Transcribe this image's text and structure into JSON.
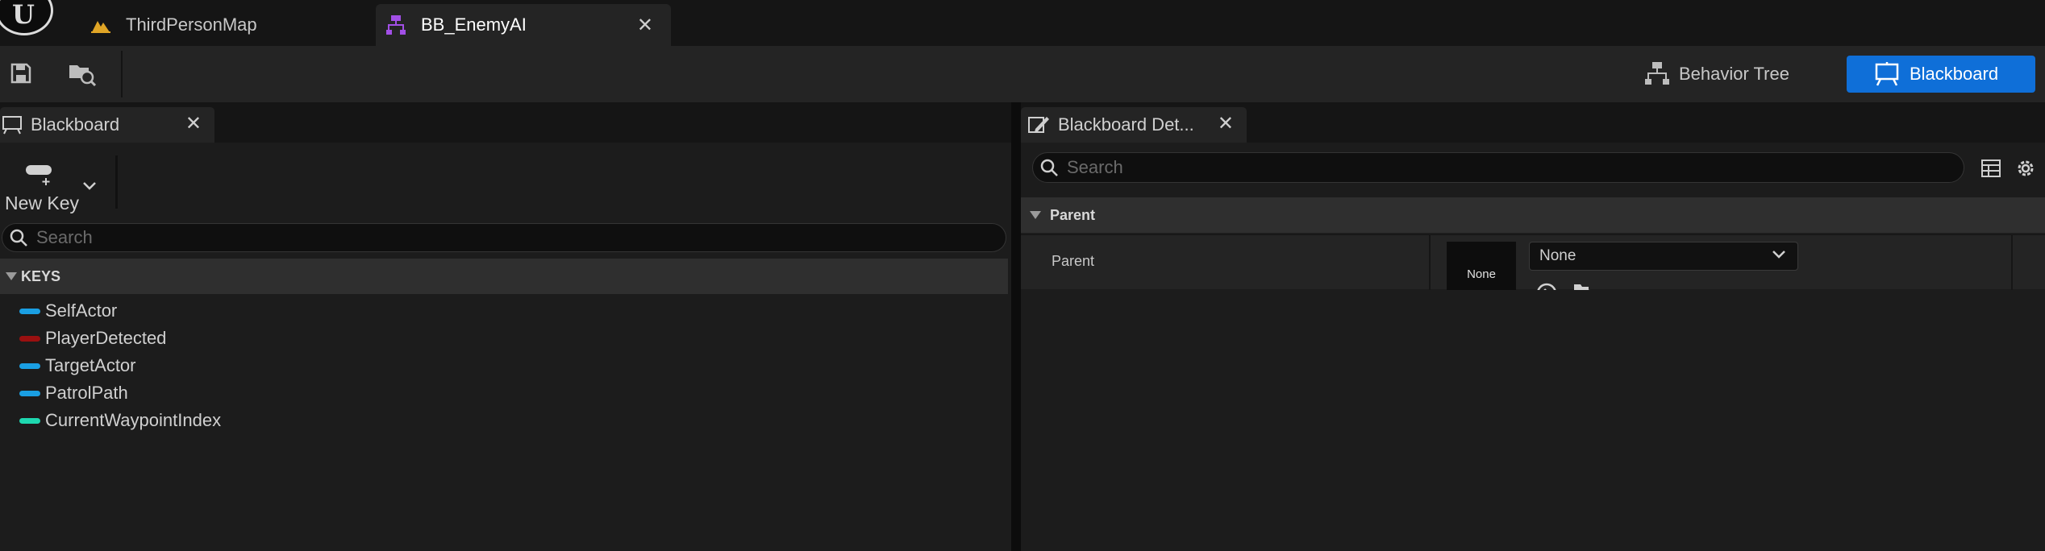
{
  "tabs": [
    {
      "label": "ThirdPersonMap",
      "icon": "level-map-icon",
      "active": false
    },
    {
      "label": "BB_EnemyAI",
      "icon": "blackboard-asset-icon",
      "active": true
    }
  ],
  "toolbar": {
    "save_icon": "save-icon",
    "browse_icon": "browse-content-icon"
  },
  "modes": {
    "behavior_tree": "Behavior Tree",
    "blackboard": "Blackboard"
  },
  "left_panel": {
    "tab_label": "Blackboard",
    "new_key_label": "New Key",
    "search_placeholder": "Search",
    "section_label": "KEYS",
    "keys": [
      {
        "name": "SelfActor",
        "color": "#1a9fe3"
      },
      {
        "name": "PlayerDetected",
        "color": "#9a1010"
      },
      {
        "name": "TargetActor",
        "color": "#1a9fe3"
      },
      {
        "name": "PatrolPath",
        "color": "#1a9fe3"
      },
      {
        "name": "CurrentWaypointIndex",
        "color": "#1ed8b0"
      }
    ]
  },
  "right_panel": {
    "tab_label": "Blackboard Det...",
    "search_placeholder": "Search",
    "section_label": "Parent",
    "property_name": "Parent",
    "thumbnail_label": "None",
    "combo_value": "None"
  },
  "colors": {
    "accent": "#0f6fd8",
    "asset_underline": "#c3214a"
  }
}
